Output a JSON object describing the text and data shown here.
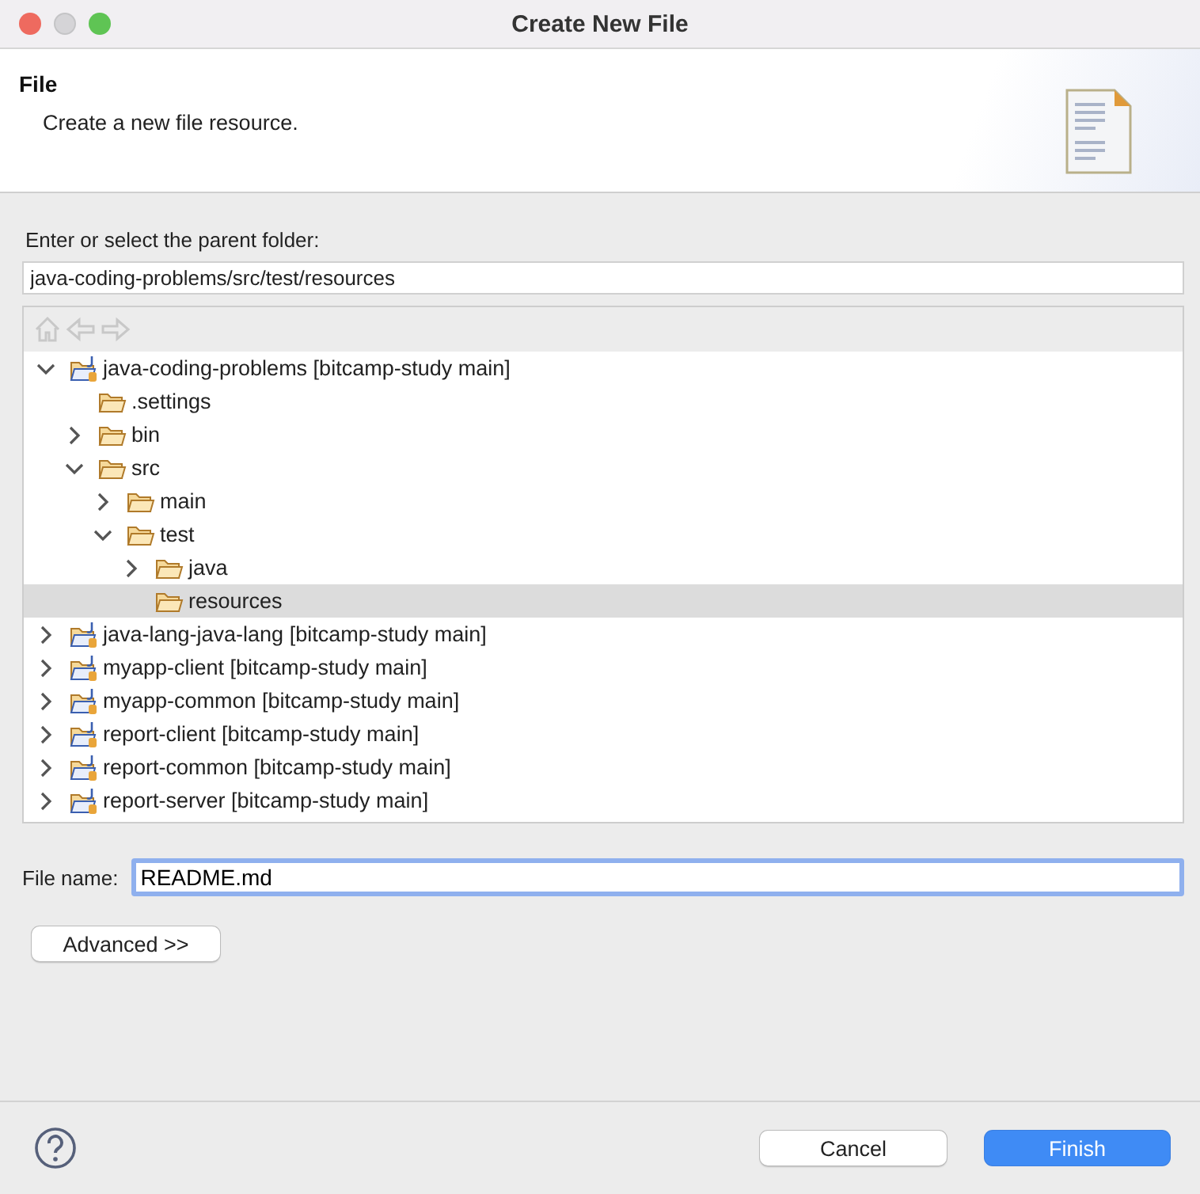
{
  "window": {
    "title": "Create New File"
  },
  "header": {
    "title": "File",
    "description": "Create a new file resource."
  },
  "parent_folder": {
    "label": "Enter or select the parent folder:",
    "value": "java-coding-problems/src/test/resources"
  },
  "tree": [
    {
      "label": "java-coding-problems [bitcamp-study main]",
      "kind": "project",
      "expandable": true,
      "expanded": true,
      "selected": false,
      "children": [
        {
          "label": ".settings",
          "kind": "folder",
          "expandable": false,
          "expanded": false,
          "selected": false
        },
        {
          "label": "bin",
          "kind": "folder",
          "expandable": true,
          "expanded": false,
          "selected": false
        },
        {
          "label": "src",
          "kind": "folder",
          "expandable": true,
          "expanded": true,
          "selected": false,
          "children": [
            {
              "label": "main",
              "kind": "folder",
              "expandable": true,
              "expanded": false,
              "selected": false
            },
            {
              "label": "test",
              "kind": "folder",
              "expandable": true,
              "expanded": true,
              "selected": false,
              "children": [
                {
                  "label": "java",
                  "kind": "folder",
                  "expandable": true,
                  "expanded": false,
                  "selected": false
                },
                {
                  "label": "resources",
                  "kind": "folder",
                  "expandable": false,
                  "expanded": false,
                  "selected": true
                }
              ]
            }
          ]
        }
      ]
    },
    {
      "label": "java-lang-java-lang [bitcamp-study main]",
      "kind": "project",
      "expandable": true,
      "expanded": false,
      "selected": false
    },
    {
      "label": "myapp-client [bitcamp-study main]",
      "kind": "project",
      "expandable": true,
      "expanded": false,
      "selected": false
    },
    {
      "label": "myapp-common [bitcamp-study main]",
      "kind": "project",
      "expandable": true,
      "expanded": false,
      "selected": false
    },
    {
      "label": "report-client [bitcamp-study main]",
      "kind": "project",
      "expandable": true,
      "expanded": false,
      "selected": false
    },
    {
      "label": "report-common [bitcamp-study main]",
      "kind": "project",
      "expandable": true,
      "expanded": false,
      "selected": false
    },
    {
      "label": "report-server [bitcamp-study main]",
      "kind": "project",
      "expandable": true,
      "expanded": false,
      "selected": false
    }
  ],
  "file_name": {
    "label": "File name:",
    "value": "README.md"
  },
  "advanced_button": "Advanced >>",
  "buttons": [
    {
      "label": "Cancel",
      "kind": "default"
    },
    {
      "label": "Finish",
      "kind": "primary"
    }
  ]
}
